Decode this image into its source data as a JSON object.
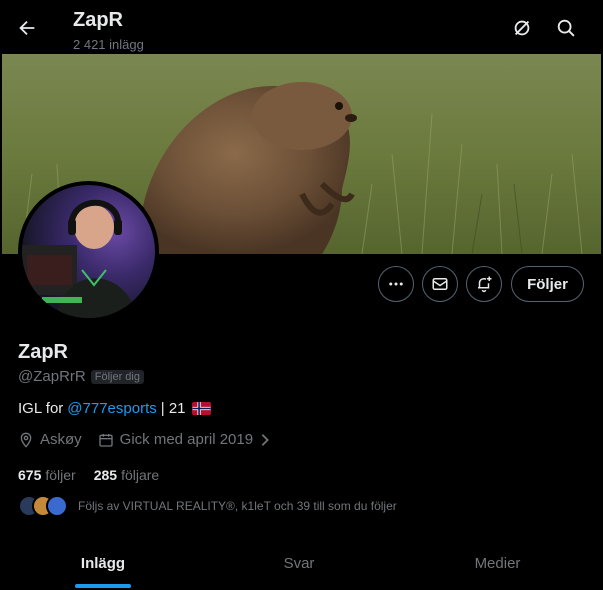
{
  "header": {
    "title": "ZapR",
    "post_count": "2 421 inlägg"
  },
  "icons": {
    "back": "arrow-left-icon",
    "grok": "grok-icon",
    "search": "search-icon",
    "more": "more-icon",
    "message": "mail-icon",
    "notify": "bell-plus-icon",
    "location": "location-pin-icon",
    "calendar": "calendar-icon",
    "chevron": "chevron-right-icon"
  },
  "actions": {
    "follow_label": "Följer"
  },
  "profile": {
    "name": "ZapR",
    "handle": "@ZapRrR",
    "follows_you": "Följer dig",
    "bio_prefix": "IGL for",
    "bio_mention": "@777esports",
    "bio_suffix": "| 21",
    "location": "Askøy",
    "joined": "Gick med april 2019"
  },
  "stats": {
    "following_count": "675",
    "following_label": "följer",
    "followers_count": "285",
    "followers_label": "följare"
  },
  "followed_by": {
    "text": "Följs av VIRTUAL REALITY®, k1leT och 39 till som du följer"
  },
  "tabs": [
    {
      "label": "Inlägg"
    },
    {
      "label": "Svar"
    },
    {
      "label": "Medier"
    }
  ],
  "colors": {
    "accent": "#1d9bf0",
    "background": "#000000",
    "text": "#e7e9ea",
    "muted": "#71767b",
    "border": "#536471"
  }
}
